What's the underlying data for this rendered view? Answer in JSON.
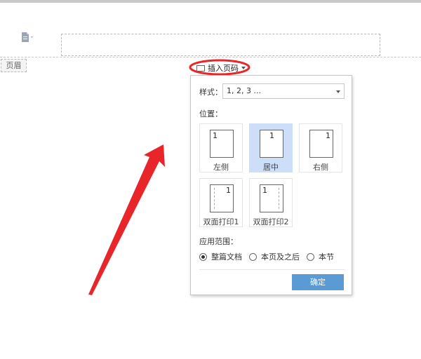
{
  "document": {
    "header_tag": "页眉"
  },
  "toolbar": {
    "insert_page_number_label": "插入页码"
  },
  "dialog": {
    "style_label": "样式：",
    "style_value": "1, 2, 3 ...",
    "position_label": "位置：",
    "positions": [
      {
        "label": "左侧",
        "number": "1",
        "selected": false
      },
      {
        "label": "居中",
        "number": "1",
        "selected": true
      },
      {
        "label": "右侧",
        "number": "1",
        "selected": false
      },
      {
        "label": "双面打印1",
        "number": "1",
        "selected": false
      },
      {
        "label": "双面打印2",
        "number": "1",
        "selected": false
      }
    ],
    "scope_label": "应用范围：",
    "scope_options": [
      {
        "label": "整篇文档",
        "checked": true
      },
      {
        "label": "本页及之后",
        "checked": false
      },
      {
        "label": "本节",
        "checked": false
      }
    ],
    "ok_label": "确定"
  },
  "colors": {
    "accent_button": "#5b9bd5",
    "selected_option": "#cddff8",
    "annotation_red": "#e8262a"
  },
  "icons": [
    "document-icon",
    "page-number-icon",
    "chevron-down-icon",
    "annotation-arrow-icon"
  ]
}
